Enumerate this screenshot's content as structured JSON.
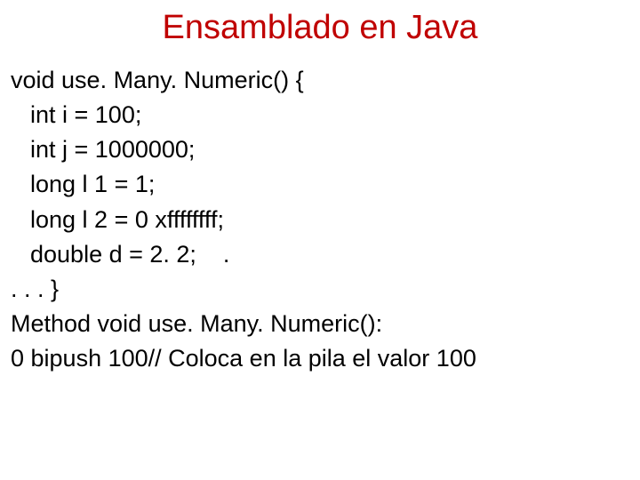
{
  "title": "Ensamblado en Java",
  "lines": [
    {
      "text": "void use. Many. Numeric() {",
      "indent": false
    },
    {
      "text": "int i = 100;",
      "indent": true
    },
    {
      "text": "int j = 1000000;",
      "indent": true
    },
    {
      "text": "long l 1 = 1;",
      "indent": true
    },
    {
      "text": "long l 2 = 0 xffffffff;",
      "indent": true
    },
    {
      "text": "double d = 2. 2;    .",
      "indent": true
    },
    {
      "text": ". . . }",
      "indent": false
    },
    {
      "text": "Method void use. Many. Numeric():",
      "indent": false
    },
    {
      "text": "0 bipush 100// Coloca en la pila el valor 100",
      "indent": false
    }
  ]
}
